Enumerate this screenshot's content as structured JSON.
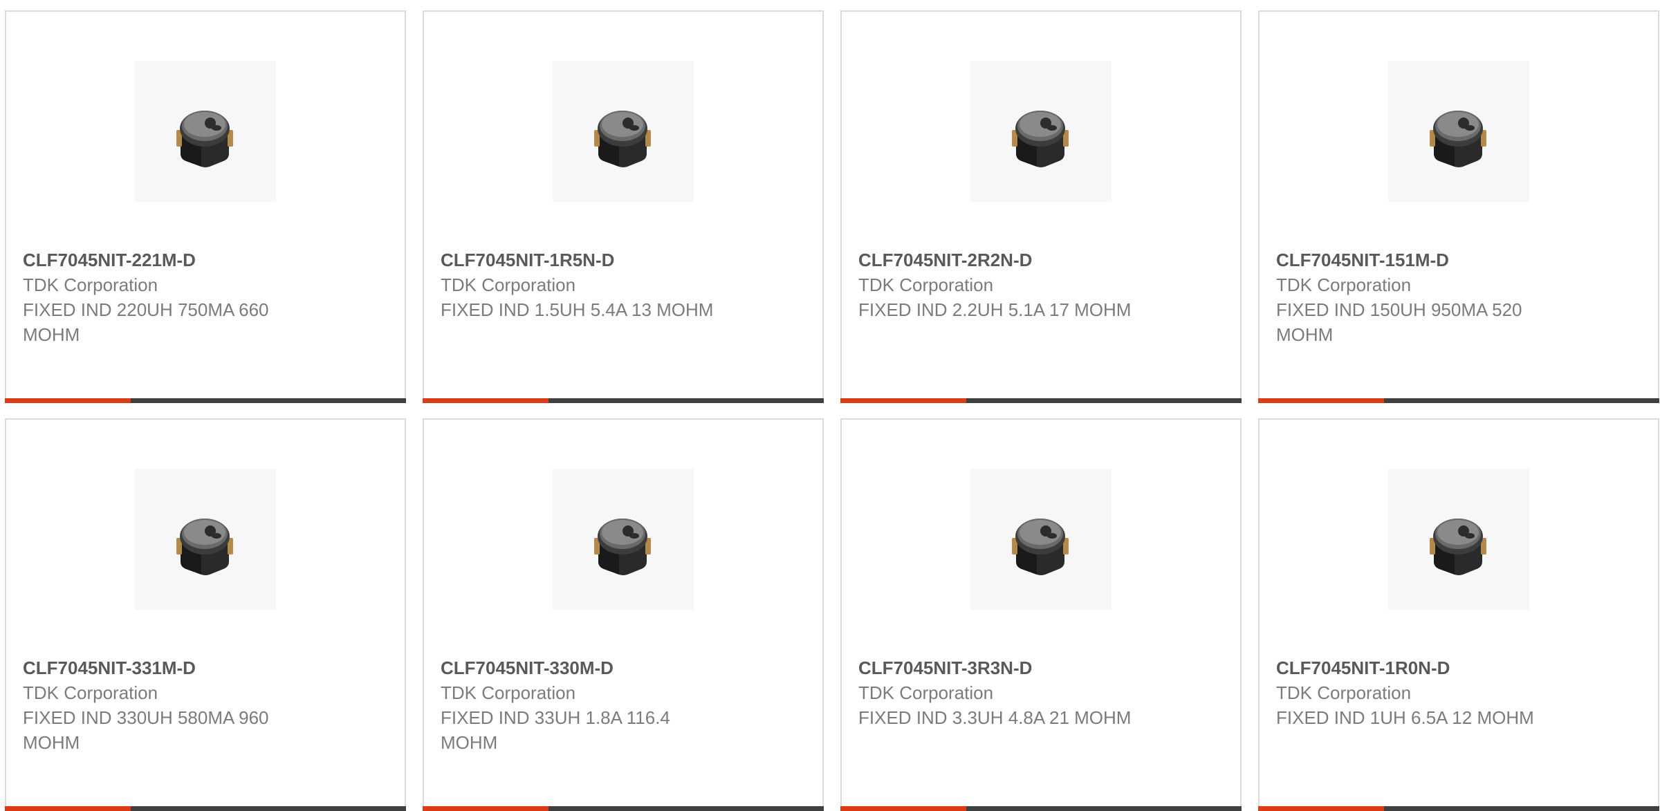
{
  "colors": {
    "accent": "#dd3b14",
    "bar_dark": "#404040",
    "text_title": "#595959",
    "text_body": "#7b7b7b",
    "border": "#dcdcdc"
  },
  "products": [
    {
      "part_number": "CLF7045NIT-221M-D",
      "manufacturer": "TDK Corporation",
      "description": "FIXED IND 220UH 750MA 660 MOHM",
      "image_icon": "inductor-product-image"
    },
    {
      "part_number": "CLF7045NIT-1R5N-D",
      "manufacturer": "TDK Corporation",
      "description": "FIXED IND 1.5UH 5.4A 13 MOHM",
      "image_icon": "inductor-product-image"
    },
    {
      "part_number": "CLF7045NIT-2R2N-D",
      "manufacturer": "TDK Corporation",
      "description": "FIXED IND 2.2UH 5.1A 17 MOHM",
      "image_icon": "inductor-product-image"
    },
    {
      "part_number": "CLF7045NIT-151M-D",
      "manufacturer": "TDK Corporation",
      "description": "FIXED IND 150UH 950MA 520 MOHM",
      "image_icon": "inductor-product-image"
    },
    {
      "part_number": "CLF7045NIT-331M-D",
      "manufacturer": "TDK Corporation",
      "description": "FIXED IND 330UH 580MA 960 MOHM",
      "image_icon": "inductor-product-image"
    },
    {
      "part_number": "CLF7045NIT-330M-D",
      "manufacturer": "TDK Corporation",
      "description": "FIXED IND 33UH 1.8A 116.4 MOHM",
      "image_icon": "inductor-product-image"
    },
    {
      "part_number": "CLF7045NIT-3R3N-D",
      "manufacturer": "TDK Corporation",
      "description": "FIXED IND 3.3UH 4.8A 21 MOHM",
      "image_icon": "inductor-product-image"
    },
    {
      "part_number": "CLF7045NIT-1R0N-D",
      "manufacturer": "TDK Corporation",
      "description": "FIXED IND 1UH 6.5A 12 MOHM",
      "image_icon": "inductor-product-image"
    }
  ]
}
